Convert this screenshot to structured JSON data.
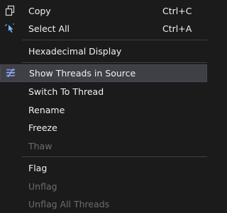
{
  "menu": {
    "copy": {
      "label": "Copy",
      "shortcut": "Ctrl+C",
      "icon": "copy-icon"
    },
    "select_all": {
      "label": "Select All",
      "shortcut": "Ctrl+A",
      "icon": "select-all-icon"
    },
    "hex": {
      "label": "Hexadecimal Display"
    },
    "show_threads": {
      "label": "Show Threads in Source",
      "icon": "show-threads-icon"
    },
    "switch_thread": {
      "label": "Switch To Thread"
    },
    "rename": {
      "label": "Rename"
    },
    "freeze": {
      "label": "Freeze"
    },
    "thaw": {
      "label": "Thaw",
      "disabled": true
    },
    "flag": {
      "label": "Flag"
    },
    "unflag": {
      "label": "Unflag",
      "disabled": true
    },
    "unflag_all": {
      "label": "Unflag All Threads",
      "disabled": true
    }
  },
  "colors": {
    "background": "#1b1b1c",
    "text": "#f1f1f1",
    "disabled_text": "#6d6d6d",
    "highlight": "#3f3f46",
    "icon_accent": "#75beff"
  }
}
